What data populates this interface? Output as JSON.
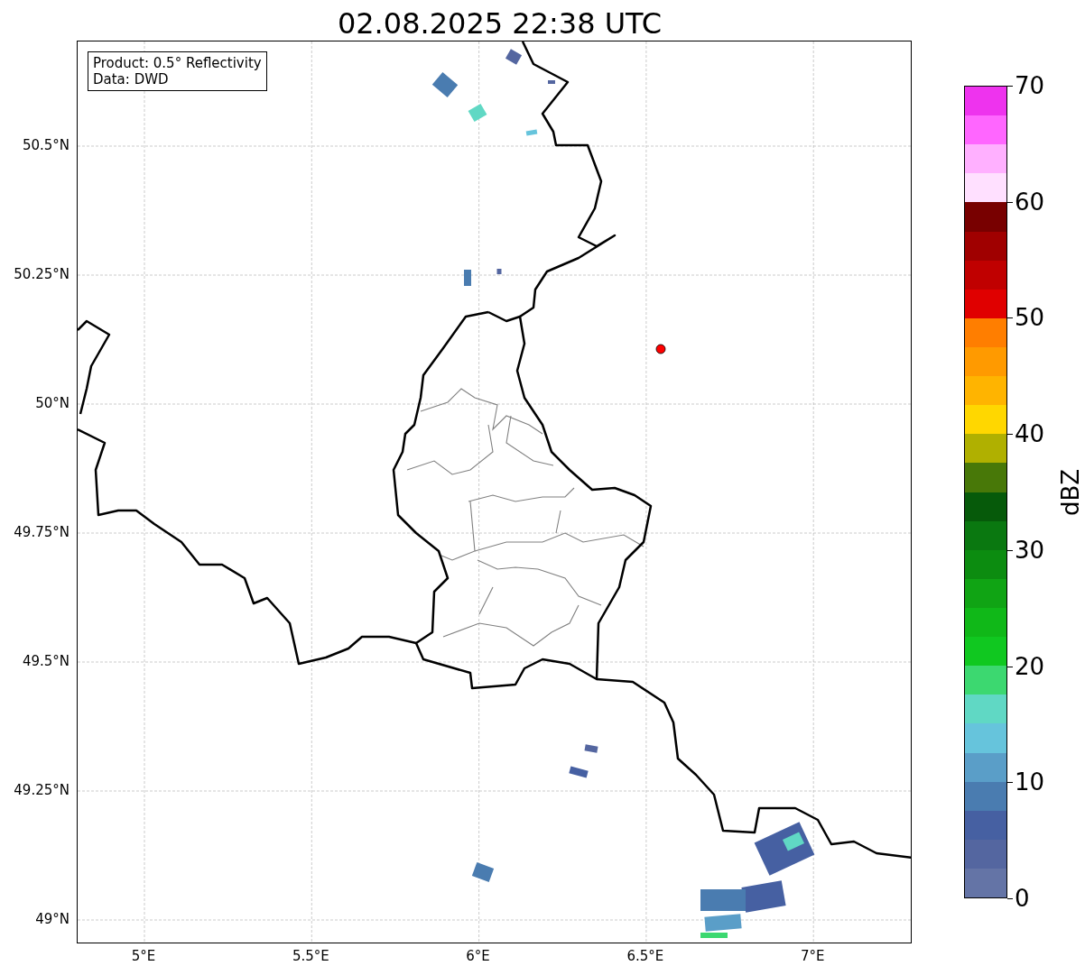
{
  "title": "02.08.2025 22:38 UTC",
  "info_box": {
    "lines": [
      "Product: 0.5° Reflectivity",
      "Data: DWD"
    ]
  },
  "map": {
    "lat_labels": [
      "50.5°N",
      "50.25°N",
      "50°N",
      "49.75°N",
      "49.5°N",
      "49.25°N",
      "49°N"
    ],
    "lon_labels": [
      "5°E",
      "5.5°E",
      "6°E",
      "6.5°E",
      "7°E"
    ]
  },
  "colorbar": {
    "label": "dBZ",
    "ticks": [
      "70",
      "60",
      "50",
      "40",
      "30",
      "20",
      "10",
      "0"
    ],
    "bins": [
      {
        "color": "#ee33ee"
      },
      {
        "color": "#ff66ff"
      },
      {
        "color": "#ffb0ff"
      },
      {
        "color": "#ffe0ff"
      },
      {
        "color": "#780000"
      },
      {
        "color": "#a00000"
      },
      {
        "color": "#c00000"
      },
      {
        "color": "#e00000"
      },
      {
        "color": "#ff7e00"
      },
      {
        "color": "#ff9a00"
      },
      {
        "color": "#ffb400"
      },
      {
        "color": "#ffd700"
      },
      {
        "color": "#b0b000"
      },
      {
        "color": "#487808"
      },
      {
        "color": "#065a0a"
      },
      {
        "color": "#0a7810"
      },
      {
        "color": "#0c8c10"
      },
      {
        "color": "#10a414"
      },
      {
        "color": "#10b818"
      },
      {
        "color": "#10c820"
      },
      {
        "color": "#3cd870"
      },
      {
        "color": "#60d8c4"
      },
      {
        "color": "#66c4dc"
      },
      {
        "color": "#5a9ec8"
      },
      {
        "color": "#4a7cb0"
      },
      {
        "color": "#4660a2"
      },
      {
        "color": "#5466a0"
      },
      {
        "color": "#6474a6"
      }
    ]
  }
}
